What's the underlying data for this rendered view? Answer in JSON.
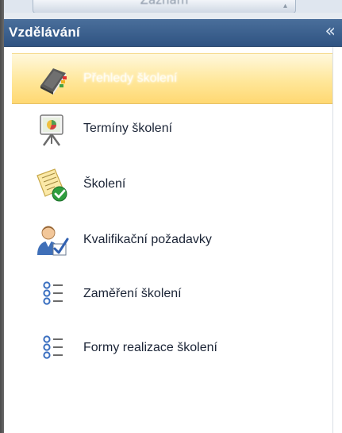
{
  "top_tab": {
    "label": "Záznam"
  },
  "panel": {
    "title": "Vzdělávání",
    "collapse_glyph": "«",
    "items": [
      {
        "label": "Přehledy školení",
        "icon": "book-icon",
        "selected": true
      },
      {
        "label": "Termíny školení",
        "icon": "presentation-easel-icon",
        "selected": false
      },
      {
        "label": "Školení",
        "icon": "document-check-icon",
        "selected": false
      },
      {
        "label": "Kvalifikační požadavky",
        "icon": "person-check-icon",
        "selected": false
      },
      {
        "label": "Zaměření školení",
        "icon": "list-icon",
        "selected": false
      },
      {
        "label": "Formy realizace školení",
        "icon": "list-icon",
        "selected": false
      }
    ]
  },
  "colors": {
    "header_bg": "#3b5f8d",
    "selected_bg": "#ffe79a",
    "text": "#1b2436"
  }
}
